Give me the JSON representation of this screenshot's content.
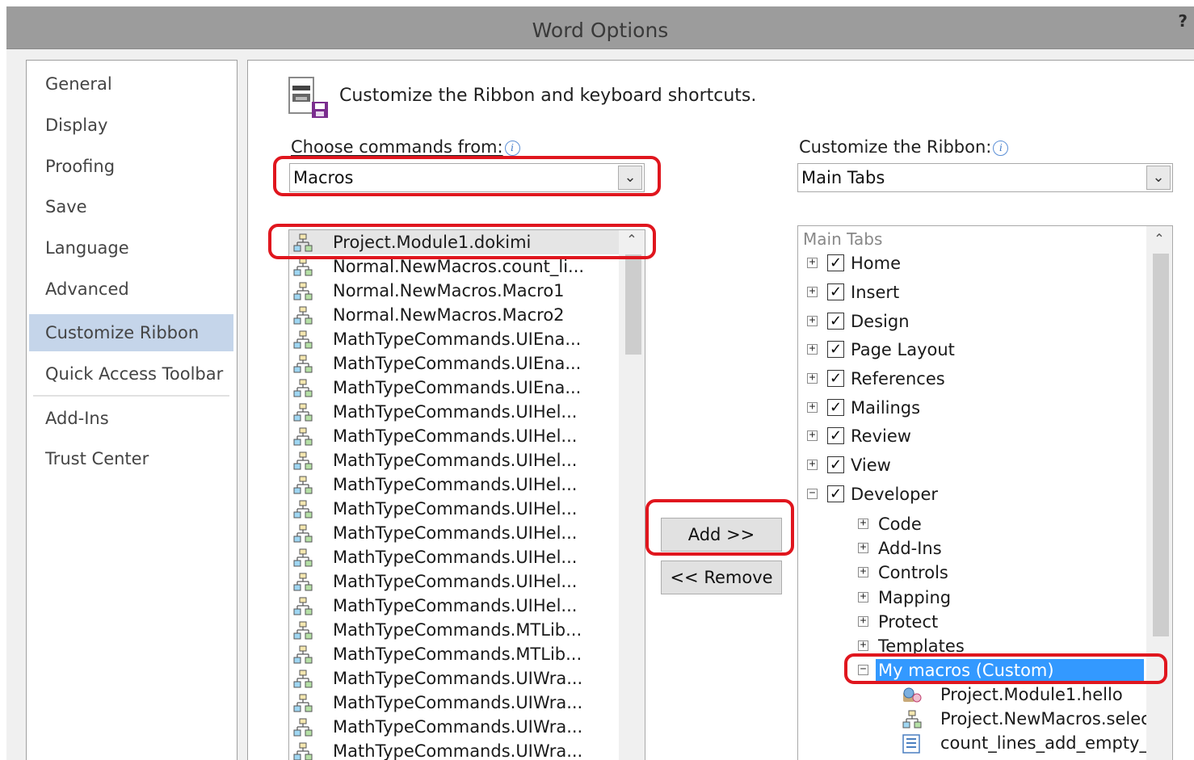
{
  "window": {
    "title": "Word Options",
    "help": "?"
  },
  "sidebar": {
    "items": [
      {
        "label": "General"
      },
      {
        "label": "Display"
      },
      {
        "label": "Proofing"
      },
      {
        "label": "Save"
      },
      {
        "label": "Language"
      },
      {
        "label": "Advanced"
      },
      {
        "label": "Customize Ribbon",
        "selected": true
      },
      {
        "label": "Quick Access Toolbar"
      },
      {
        "label": "Add-Ins"
      },
      {
        "label": "Trust Center"
      }
    ]
  },
  "header": {
    "heading": "Customize the Ribbon and keyboard shortcuts.",
    "icon": "customize-ribbon-icon"
  },
  "commands": {
    "label": "Choose commands from:",
    "selected": "Macros",
    "items": [
      "Project.Module1.dokimi",
      "Normal.NewMacros.count_li...",
      "Normal.NewMacros.Macro1",
      "Normal.NewMacros.Macro2",
      "MathTypeCommands.UIEna...",
      "MathTypeCommands.UIEna...",
      "MathTypeCommands.UIEna...",
      "MathTypeCommands.UIHel...",
      "MathTypeCommands.UIHel...",
      "MathTypeCommands.UIHel...",
      "MathTypeCommands.UIHel...",
      "MathTypeCommands.UIHel...",
      "MathTypeCommands.UIHel...",
      "MathTypeCommands.UIHel...",
      "MathTypeCommands.UIHel...",
      "MathTypeCommands.UIHel...",
      "MathTypeCommands.MTLib...",
      "MathTypeCommands.MTLib...",
      "MathTypeCommands.UIWra...",
      "MathTypeCommands.UIWra...",
      "MathTypeCommands.UIWra...",
      "MathTypeCommands.UIWra..."
    ]
  },
  "buttons": {
    "add": "Add >>",
    "remove": "<< Remove"
  },
  "ribbon": {
    "label": "Customize the Ribbon:",
    "selected": "Main Tabs",
    "header": "Main Tabs",
    "tabs": [
      {
        "label": "Home",
        "expand": "+",
        "checked": true
      },
      {
        "label": "Insert",
        "expand": "+",
        "checked": true
      },
      {
        "label": "Design",
        "expand": "+",
        "checked": true
      },
      {
        "label": "Page Layout",
        "expand": "+",
        "checked": true
      },
      {
        "label": "References",
        "expand": "+",
        "checked": true
      },
      {
        "label": "Mailings",
        "expand": "+",
        "checked": true
      },
      {
        "label": "Review",
        "expand": "+",
        "checked": true
      },
      {
        "label": "View",
        "expand": "+",
        "checked": true
      },
      {
        "label": "Developer",
        "expand": "−",
        "checked": true
      }
    ],
    "groups": [
      {
        "label": "Code",
        "expand": "+"
      },
      {
        "label": "Add-Ins",
        "expand": "+"
      },
      {
        "label": "Controls",
        "expand": "+"
      },
      {
        "label": "Mapping",
        "expand": "+"
      },
      {
        "label": "Protect",
        "expand": "+"
      },
      {
        "label": "Templates",
        "expand": "+"
      },
      {
        "label": "My macros (Custom)",
        "expand": "−",
        "selected": true
      }
    ],
    "custom_items": [
      {
        "label": "Project.Module1.hello",
        "icon": "macro-smiley-icon"
      },
      {
        "label": "Project.NewMacros.select",
        "icon": "macro-icon"
      },
      {
        "label": "count_lines_add_empty_li",
        "icon": "document-list-icon"
      }
    ]
  },
  "colors": {
    "highlight": "#e0161e",
    "selection": "#3399ff",
    "nav_selected": "#c5d5ea"
  }
}
